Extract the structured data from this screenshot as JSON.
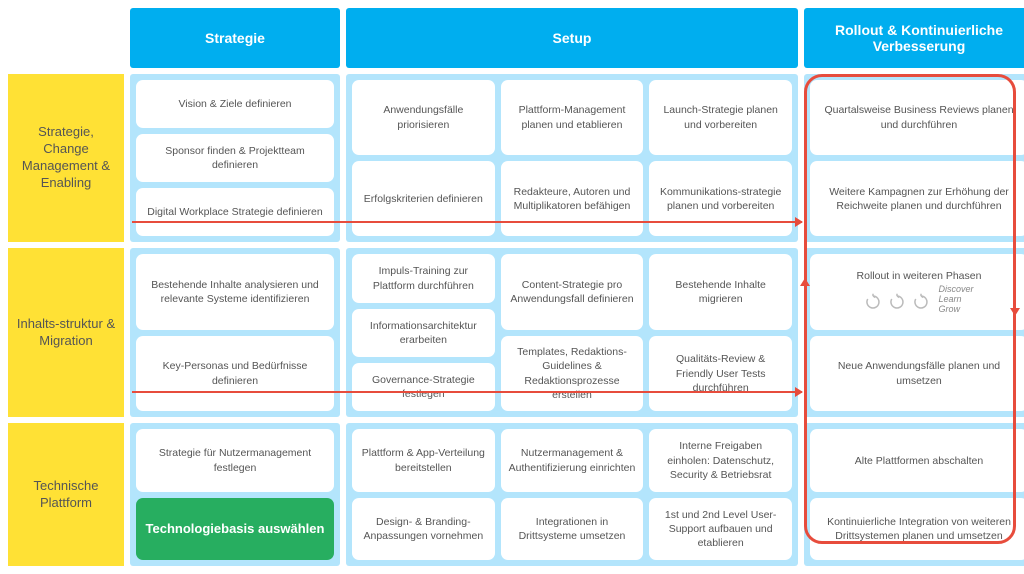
{
  "columns": {
    "strategie": "Strategie",
    "setup": "Setup",
    "rollout": "Rollout & Kontinuierliche Verbesserung"
  },
  "rows": {
    "r1": "Strategie, Change Management & Enabling",
    "r2": "Inhalts-struktur & Migration",
    "r3": "Technische Plattform"
  },
  "r1c1": [
    "Vision & Ziele definieren",
    "Sponsor finden & Projektteam definieren",
    "Digital Workplace Strategie definieren"
  ],
  "r1c2a": [
    "Anwendungsfälle priorisieren",
    "Erfolgskriterien definieren"
  ],
  "r1c2b": [
    "Plattform-Management planen und etablieren",
    "Redakteure, Autoren und Multiplikatoren befähigen"
  ],
  "r1c2c": [
    "Launch-Strategie planen und vorbereiten",
    "Kommunikations-strategie planen und vorbereiten"
  ],
  "r1c3": [
    "Quartalsweise Business Reviews planen und durchführen",
    "Weitere Kampagnen zur Erhöhung der Reichweite planen und durchführen"
  ],
  "r2c1": [
    "Bestehende Inhalte analysieren und relevante Systeme identifizieren",
    "Key-Personas und Bedürfnisse definieren"
  ],
  "r2c2a": [
    "Impuls-Training zur Plattform durchführen",
    "Informationsarchitektur erarbeiten",
    "Governance-Strategie festlegen"
  ],
  "r2c2b": [
    "Content-Strategie pro Anwendungsfall definieren",
    "Templates, Redaktions-Guidelines & Redaktionsprozesse erstellen"
  ],
  "r2c2c": [
    "Bestehende Inhalte migrieren",
    "Qualitäts-Review & Friendly User Tests durchführen"
  ],
  "r2c3_phase": "Rollout in weiteren Phasen",
  "r2c3_cycle": "Discover\nLearn\nGrow",
  "r2c3b": "Neue Anwendungsfälle planen und umsetzen",
  "r3c1a": "Strategie für Nutzermanagement festlegen",
  "r3c1b": "Technologiebasis auswählen",
  "r3c2a": [
    "Plattform & App-Verteilung bereitstellen",
    "Design- & Branding-Anpassungen vornehmen"
  ],
  "r3c2b": [
    "Nutzermanagement & Authentifizierung einrichten",
    "Integrationen in Drittsysteme umsetzen"
  ],
  "r3c2c": [
    "Interne Freigaben einholen: Datenschutz, Security & Betriebsrat",
    "1st und 2nd Level User-Support aufbauen und etablieren"
  ],
  "r3c3": [
    "Alte Plattformen abschalten",
    "Kontinuierliche Integration von weiteren Drittsystemen planen und umsetzen"
  ]
}
